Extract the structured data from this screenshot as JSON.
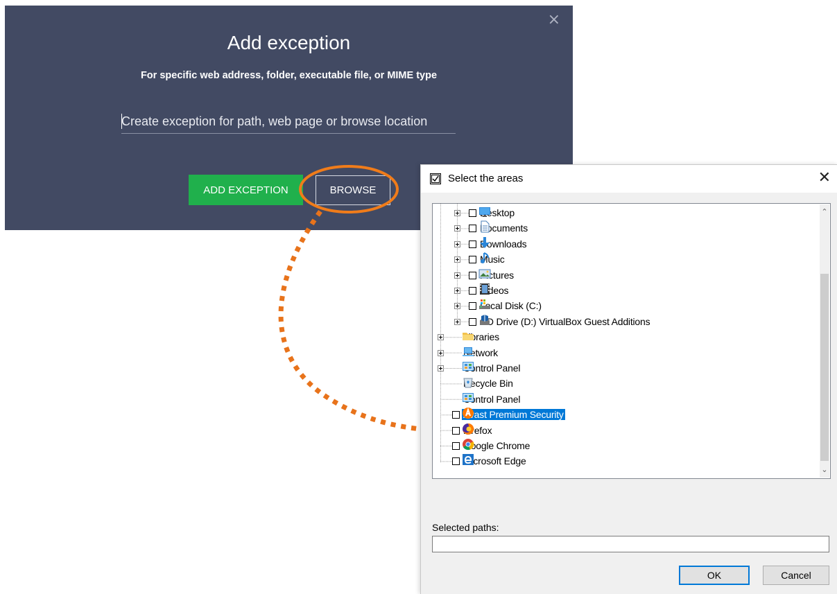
{
  "avast": {
    "title": "Add exception",
    "subtitle": "For specific web address, folder, executable file, or MIME type",
    "input_placeholder": "Create exception for path, web page or browse location",
    "input_value": "",
    "add_button": "ADD EXCEPTION",
    "browse_button": "BROWSE",
    "close_glyph": "×",
    "colors": {
      "panel": "#424a63",
      "add_button": "#20b04c",
      "highlight": "#f07c1a"
    }
  },
  "dialog": {
    "title": "Select the areas",
    "close_glyph": "✕",
    "tree": [
      {
        "label": "Desktop",
        "icon": "desktop-icon",
        "level": 1,
        "expander": true,
        "checkbox": true
      },
      {
        "label": "Documents",
        "icon": "document-icon",
        "level": 1,
        "expander": true,
        "checkbox": true
      },
      {
        "label": "Downloads",
        "icon": "download-icon",
        "level": 1,
        "expander": true,
        "checkbox": true
      },
      {
        "label": "Music",
        "icon": "music-icon",
        "level": 1,
        "expander": true,
        "checkbox": true
      },
      {
        "label": "Pictures",
        "icon": "pictures-icon",
        "level": 1,
        "expander": true,
        "checkbox": true
      },
      {
        "label": "Videos",
        "icon": "videos-icon",
        "level": 1,
        "expander": true,
        "checkbox": true
      },
      {
        "label": "Local Disk (C:)",
        "icon": "local-disk-icon",
        "level": 1,
        "expander": true,
        "checkbox": true
      },
      {
        "label": "CD Drive (D:) VirtualBox Guest Additions",
        "icon": "cd-drive-icon",
        "level": 1,
        "expander": true,
        "checkbox": true
      },
      {
        "label": "Libraries",
        "icon": "libraries-icon",
        "level": 0,
        "expander": true,
        "checkbox": false
      },
      {
        "label": "Network",
        "icon": "network-icon",
        "level": 0,
        "expander": true,
        "checkbox": false
      },
      {
        "label": "Control Panel",
        "icon": "control-panel-icon",
        "level": 0,
        "expander": true,
        "checkbox": false
      },
      {
        "label": "Recycle Bin",
        "icon": "recycle-bin-icon",
        "level": 0,
        "expander": false,
        "checkbox": false
      },
      {
        "label": "Control Panel",
        "icon": "control-panel-icon",
        "level": 0,
        "expander": false,
        "checkbox": false
      },
      {
        "label": "Avast Premium Security",
        "icon": "avast-icon",
        "level": 0,
        "expander": false,
        "checkbox": true,
        "selected": true
      },
      {
        "label": "Firefox",
        "icon": "firefox-icon",
        "level": 0,
        "expander": false,
        "checkbox": true
      },
      {
        "label": "Google Chrome",
        "icon": "chrome-icon",
        "level": 0,
        "expander": false,
        "checkbox": true
      },
      {
        "label": "Microsoft Edge",
        "icon": "edge-icon",
        "level": 0,
        "expander": false,
        "checkbox": true
      }
    ],
    "selected_paths_label": "Selected paths:",
    "selected_paths_value": "",
    "ok_button": "OK",
    "cancel_button": "Cancel",
    "scroll_up_glyph": "^",
    "scroll_down_glyph": "v"
  }
}
